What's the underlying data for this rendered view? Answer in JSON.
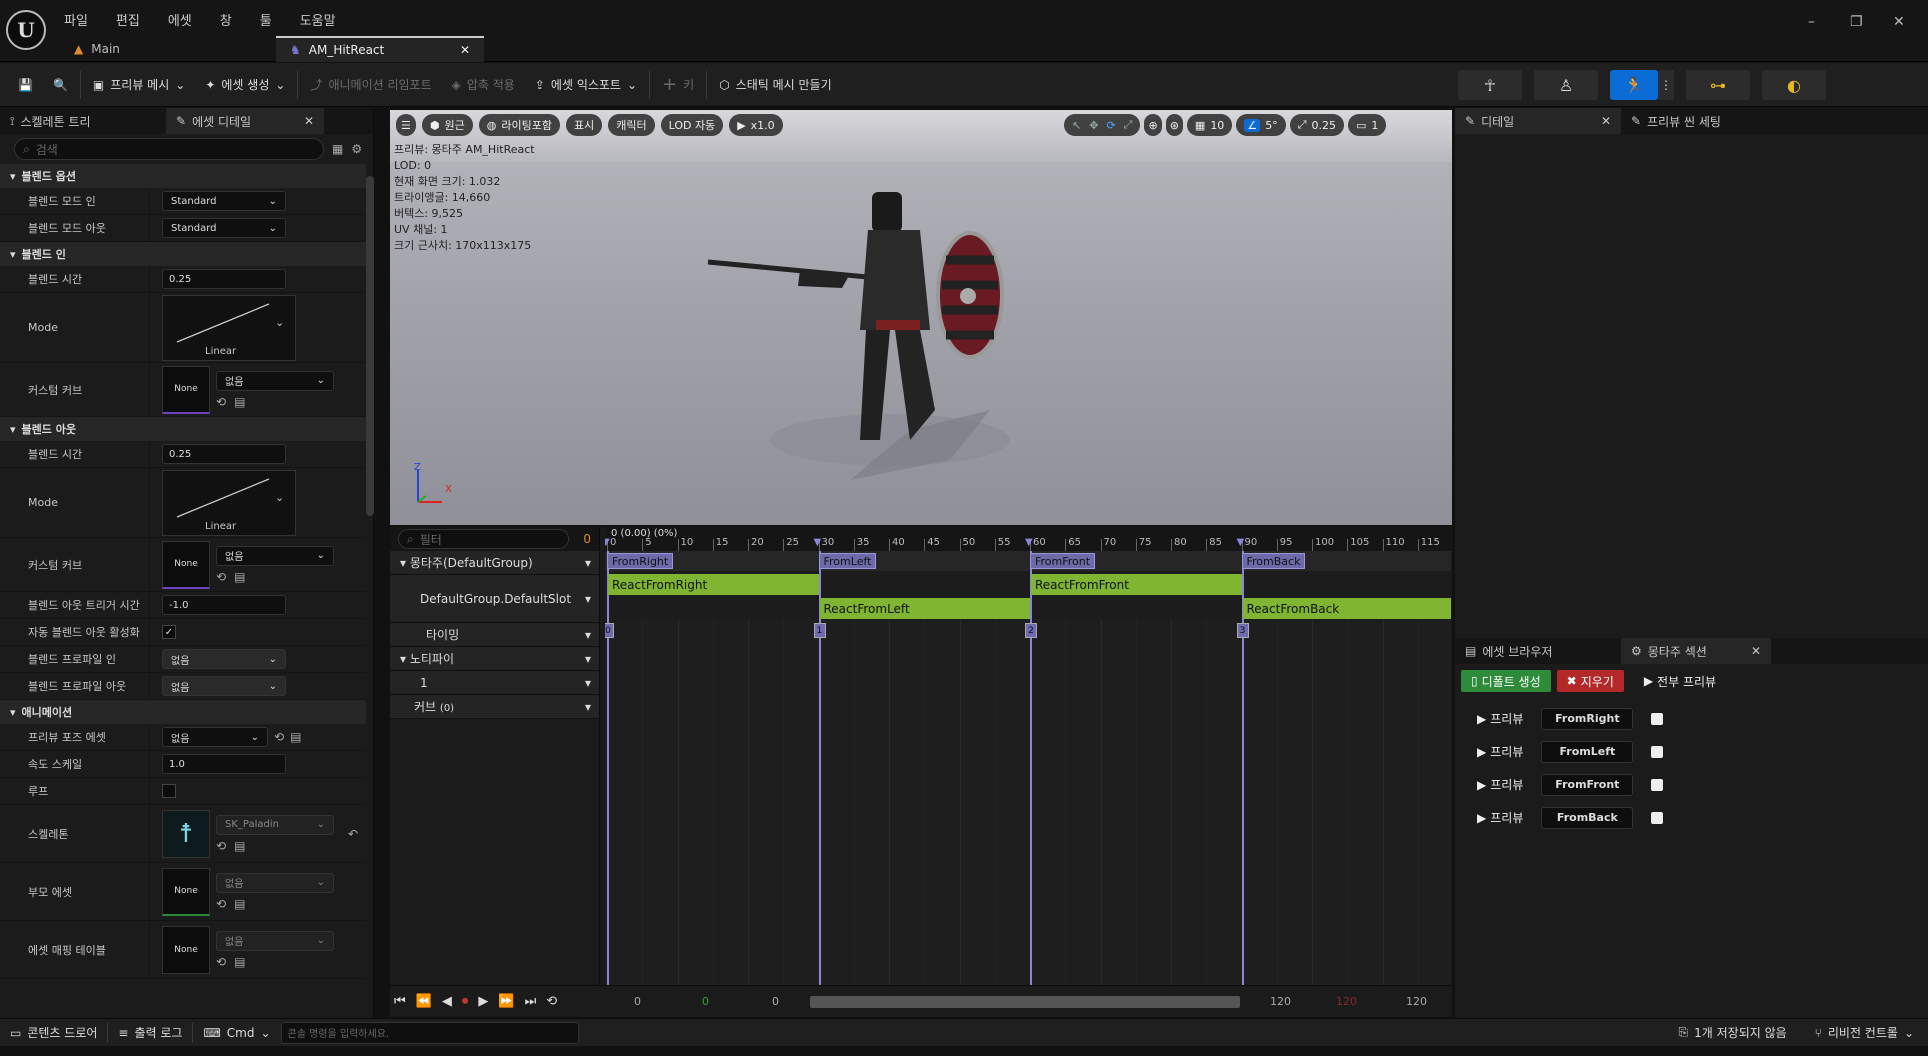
{
  "app": {
    "logo": "U",
    "menu": [
      "파일",
      "편집",
      "에셋",
      "창",
      "툴",
      "도움말"
    ],
    "tabs": [
      {
        "label": "Main"
      },
      {
        "label": "AM_HitReact"
      }
    ],
    "window_controls": [
      "–",
      "❐",
      "✕"
    ]
  },
  "toolbar": {
    "preview_mesh": "프리뷰 메시",
    "create_asset": "에셋 생성",
    "anim_reimport": "애니메이션 리임포트",
    "apply_compress": "압축 적용",
    "export_asset": "에셋 익스포트",
    "key": "키",
    "make_static_mesh": "스태틱 메시 만들기"
  },
  "left_panel": {
    "tabs": [
      "스켈레톤 트리",
      "에셋 디테일"
    ],
    "search_placeholder": "검색",
    "blend_options": {
      "title": "블렌드 옵션",
      "blend_mode_in_label": "블렌드 모드 인",
      "blend_mode_in": "Standard",
      "blend_mode_out_label": "블렌드 모드 아웃",
      "blend_mode_out": "Standard"
    },
    "blend_in": {
      "title": "블렌드 인",
      "time_label": "블렌드 시간",
      "time": "0.25",
      "mode_label": "Mode",
      "mode": "Linear",
      "curve_label": "커스텀 커브",
      "curve_thumb": "None",
      "curve_value": "없음"
    },
    "blend_out": {
      "title": "블렌드 아웃",
      "time_label": "블렌드 시간",
      "time": "0.25",
      "mode_label": "Mode",
      "mode": "Linear",
      "curve_label": "커스텀 커브",
      "curve_thumb": "None",
      "curve_value": "없음"
    },
    "blend_out_trigger_label": "블렌드 아웃 트리거 시간",
    "blend_out_trigger": "-1.0",
    "auto_blend_out_label": "자동 블렌드 아웃 활성화",
    "auto_blend_out_checked": true,
    "profile_in_label": "블렌드 프로파일 인",
    "profile_in": "없음",
    "profile_out_label": "블렌드 프로파일 아웃",
    "profile_out": "없음",
    "animation": {
      "title": "애니메이션",
      "preview_pose_label": "프리뷰 포즈 에셋",
      "preview_pose": "없음",
      "rate_scale_label": "속도 스케일",
      "rate_scale": "1.0",
      "loop_label": "루프",
      "skeleton_label": "스켈레톤",
      "skeleton": "SK_Paladin",
      "parent_label": "부모 에셋",
      "parent_thumb": "None",
      "parent": "없음",
      "mapping_label": "에셋 매핑 테이블",
      "mapping_thumb": "None",
      "mapping": "없음"
    }
  },
  "viewport": {
    "menu_icon": "☰",
    "perspective": "원근",
    "lit": "라이팅포함",
    "show": "표시",
    "character": "캐릭터",
    "lod": "LOD 자동",
    "speed": "x1.0",
    "grid": "10",
    "angle": "5°",
    "scale": "0.25",
    "cam": "1",
    "info": [
      "프리뷰: 몽타주 AM_HitReact",
      "LOD: 0",
      "현재 화면 크기: 1.032",
      "트라이앵글: 14,660",
      "버텍스: 9,525",
      "UV 채널: 1",
      "크기 근사치: 170x113x175"
    ],
    "axis_x": "X",
    "axis_z": "Z"
  },
  "sequencer": {
    "filter_placeholder": "필터",
    "filter_count": "0",
    "time_display": "0 (0.00) (0%)",
    "ticks": [
      "0",
      "5",
      "10",
      "15",
      "20",
      "25",
      "30",
      "35",
      "40",
      "45",
      "50",
      "55",
      "60",
      "65",
      "70",
      "75",
      "80",
      "85",
      "90",
      "95",
      "100",
      "105",
      "110",
      "115"
    ],
    "tracks": {
      "montage": "몽타주(DefaultGroup)",
      "slot": "DefaultGroup.DefaultSlot",
      "timing": "타이밍",
      "notify": "노티파이",
      "notify_track": "1",
      "curve": "커브",
      "curve_count": "(0)"
    },
    "sections": [
      "FromRight",
      "FromLeft",
      "FromFront",
      "FromBack"
    ],
    "segments": [
      "ReactFromRight",
      "ReactFromLeft",
      "ReactFromFront",
      "ReactFromBack"
    ],
    "markers": [
      "0",
      "1",
      "2",
      "3"
    ],
    "transport_values": [
      "0",
      "0",
      "0",
      "120",
      "120",
      "120"
    ]
  },
  "right_panel": {
    "tabs": [
      "디테일",
      "프리뷰 씬 세팅"
    ],
    "bottom_tabs": [
      "에셋 브라우저",
      "몽타주 섹션"
    ],
    "create_default": "디폴트 생성",
    "clear": "지우기",
    "preview_all": "전부 프리뷰",
    "sections": [
      {
        "preview": "프리뷰",
        "name": "FromRight"
      },
      {
        "preview": "프리뷰",
        "name": "FromLeft"
      },
      {
        "preview": "프리뷰",
        "name": "FromFront"
      },
      {
        "preview": "프리뷰",
        "name": "FromBack"
      }
    ]
  },
  "status": {
    "content_drawer": "콘텐츠 드로어",
    "output_log": "출력 로그",
    "cmd": "Cmd",
    "console_placeholder": "콘솔 명령을 입력하세요.",
    "unsaved": "1개 저장되지 않음",
    "revision": "리비전 컨트롤"
  }
}
